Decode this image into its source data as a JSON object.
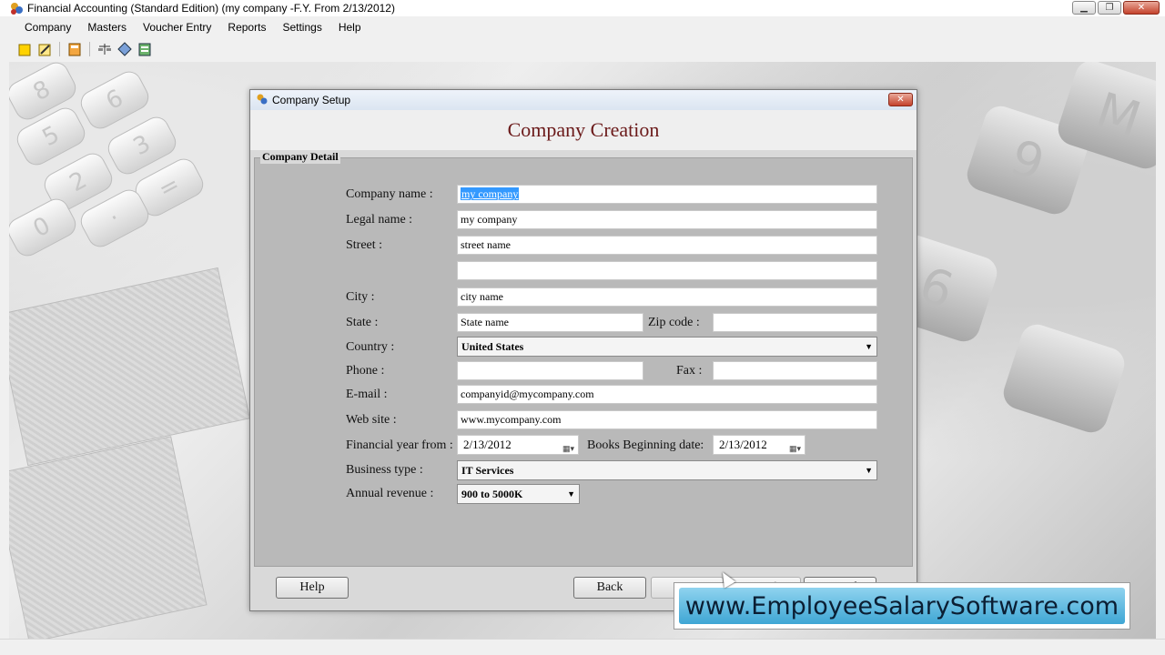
{
  "window": {
    "title": "Financial Accounting (Standard Edition) (my company -F.Y. From 2/13/2012)"
  },
  "menu": [
    "Company",
    "Masters",
    "Voucher Entry",
    "Reports",
    "Settings",
    "Help"
  ],
  "toolbar": [
    "new-icon",
    "edit-icon",
    "calculator-icon",
    "scale-icon",
    "gear-icon",
    "report-icon"
  ],
  "dialog": {
    "title": "Company Setup",
    "heading": "Company Creation",
    "group_label": "Company Detail",
    "labels": {
      "company_name": "Company name :",
      "legal_name": "Legal name :",
      "street": "Street :",
      "city": "City :",
      "state": "State :",
      "zip": "Zip code :",
      "country": "Country :",
      "phone": "Phone :",
      "fax": "Fax :",
      "email": "E-mail :",
      "website": "Web site :",
      "fy_from": "Financial year from :",
      "books_begin": "Books Beginning date:",
      "business_type": "Business type :",
      "annual_revenue": "Annual revenue :"
    },
    "values": {
      "company_name": "my company",
      "legal_name": "my company",
      "street1": "street name",
      "street2": "",
      "city": "city name",
      "state": "State name",
      "zip": "",
      "country": "United States",
      "phone": "",
      "fax": "",
      "email": "companyid@mycompany.com",
      "website": "www.mycompany.com",
      "fy_from": "2/13/2012",
      "books_begin": "2/13/2012",
      "business_type": "IT Services",
      "annual_revenue": "900 to 5000K"
    },
    "buttons": {
      "help": "Help",
      "back": "Back",
      "next": "Next",
      "finish": "Finish",
      "cancel": "Cancel"
    }
  },
  "banner": {
    "text": "www.EmployeeSalarySoftware.com"
  }
}
